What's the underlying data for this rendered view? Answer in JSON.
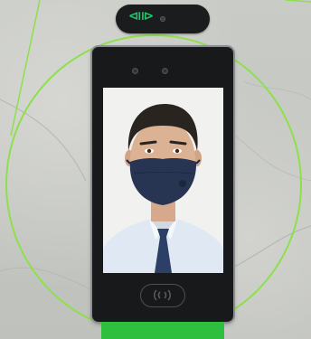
{
  "scene": {
    "brand_mark_glyph": "⧏⧐",
    "colors": {
      "ring": "#8ee04a",
      "device_body": "#18191b",
      "stand": "#2fbf3f",
      "mask": "#283552",
      "shirt": "#dfe8f3",
      "tie": "#2c3f66"
    },
    "icons": [
      "brand-logo-icon",
      "camera-icon",
      "nfc-reader-icon"
    ]
  }
}
